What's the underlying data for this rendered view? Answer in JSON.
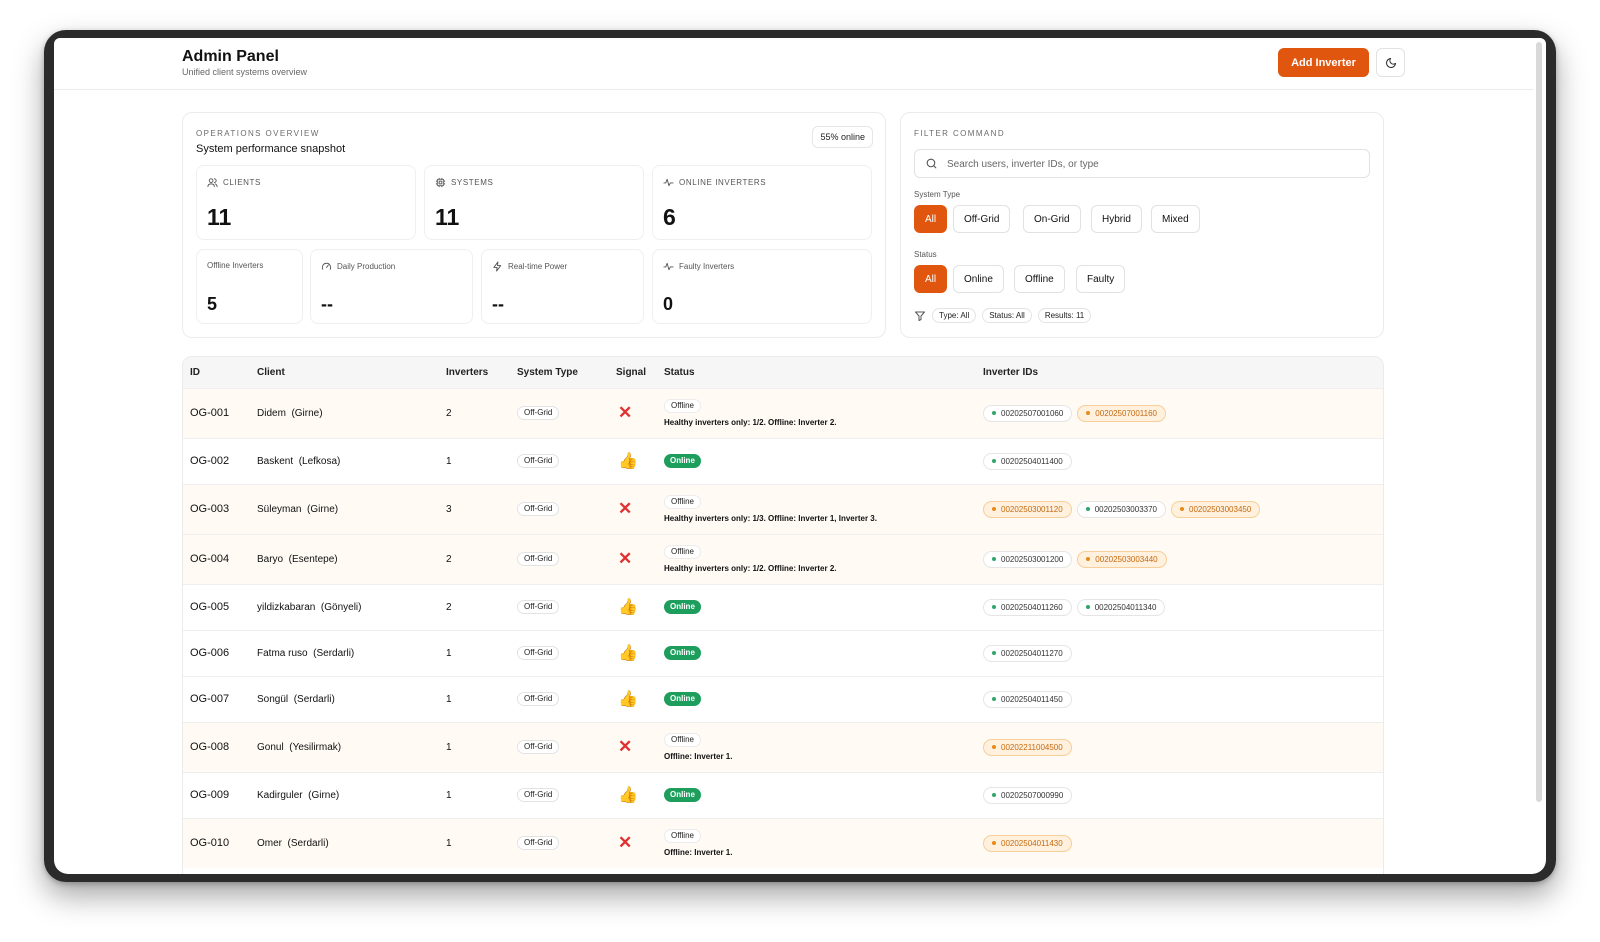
{
  "header": {
    "title": "Admin Panel",
    "subtitle": "Unified client systems overview",
    "add_button": "Add Inverter",
    "theme_icon": "moon-icon"
  },
  "overview": {
    "eyebrow": "OPERATIONS OVERVIEW",
    "title": "System performance snapshot",
    "online_pill": "55% online",
    "clients": {
      "label": "CLIENTS",
      "value": "11",
      "icon": "users-icon"
    },
    "systems": {
      "label": "SYSTEMS",
      "value": "11",
      "icon": "cpu-icon"
    },
    "online_inverters": {
      "label": "ONLINE INVERTERS",
      "value": "6",
      "icon": "activity-icon"
    },
    "offline_inverters": {
      "label": "Offline Inverters",
      "value": "5"
    },
    "daily_production": {
      "label": "Daily Production",
      "value": "--",
      "icon": "gauge-icon"
    },
    "realtime_power": {
      "label": "Real-time Power",
      "value": "--",
      "icon": "bolt-icon"
    },
    "faulty_inverters": {
      "label": "Faulty Inverters",
      "value": "0",
      "icon": "activity-icon"
    }
  },
  "filter": {
    "eyebrow": "FILTER COMMAND",
    "search_placeholder": "Search users, inverter IDs, or type",
    "system_type_label": "System Type",
    "system_types": [
      "All",
      "Off-Grid",
      "On-Grid",
      "Hybrid",
      "Mixed"
    ],
    "status_label": "Status",
    "statuses": [
      "All",
      "Online",
      "Offline",
      "Faulty"
    ],
    "summary": {
      "type": "Type: All",
      "status": "Status: All",
      "results": "Results: 11"
    }
  },
  "table": {
    "headers": {
      "id": "ID",
      "client": "Client",
      "inverters": "Inverters",
      "system_type": "System Type",
      "signal": "Signal",
      "status": "Status",
      "inverter_ids": "Inverter IDs"
    },
    "colors": {
      "online": "#1e9e5d",
      "offline_accent": "#e88a1a",
      "primary": "#e0560e"
    },
    "rows": [
      {
        "id": "OG-001",
        "client": "Didem  (Girne)",
        "inverters": "2",
        "system_type": "Off-Grid",
        "online": false,
        "status": "Offline",
        "note": "Healthy inverters only: 1/2. Offline: Inverter 2.",
        "ids": [
          {
            "v": "00202507001060",
            "ok": true
          },
          {
            "v": "00202507001160",
            "ok": false
          }
        ]
      },
      {
        "id": "OG-002",
        "client": "Baskent  (Lefkosa)",
        "inverters": "1",
        "system_type": "Off-Grid",
        "online": true,
        "status": "Online",
        "note": "",
        "ids": [
          {
            "v": "00202504011400",
            "ok": true
          }
        ]
      },
      {
        "id": "OG-003",
        "client": "Süleyman  (Girne)",
        "inverters": "3",
        "system_type": "Off-Grid",
        "online": false,
        "status": "Offline",
        "note": "Healthy inverters only: 1/3. Offline: Inverter 1, Inverter 3.",
        "ids": [
          {
            "v": "00202503001120",
            "ok": false
          },
          {
            "v": "00202503003370",
            "ok": true
          },
          {
            "v": "00202503003450",
            "ok": false
          }
        ]
      },
      {
        "id": "OG-004",
        "client": "Baryo  (Esentepe)",
        "inverters": "2",
        "system_type": "Off-Grid",
        "online": false,
        "status": "Offline",
        "note": "Healthy inverters only: 1/2. Offline: Inverter 2.",
        "ids": [
          {
            "v": "00202503001200",
            "ok": true
          },
          {
            "v": "00202503003440",
            "ok": false
          }
        ]
      },
      {
        "id": "OG-005",
        "client": "yildizkabaran  (Gönyeli)",
        "inverters": "2",
        "system_type": "Off-Grid",
        "online": true,
        "status": "Online",
        "note": "",
        "ids": [
          {
            "v": "00202504011260",
            "ok": true
          },
          {
            "v": "00202504011340",
            "ok": true
          }
        ]
      },
      {
        "id": "OG-006",
        "client": "Fatma ruso  (Serdarli)",
        "inverters": "1",
        "system_type": "Off-Grid",
        "online": true,
        "status": "Online",
        "note": "",
        "ids": [
          {
            "v": "00202504011270",
            "ok": true
          }
        ]
      },
      {
        "id": "OG-007",
        "client": "Songül  (Serdarli)",
        "inverters": "1",
        "system_type": "Off-Grid",
        "online": true,
        "status": "Online",
        "note": "",
        "ids": [
          {
            "v": "00202504011450",
            "ok": true
          }
        ]
      },
      {
        "id": "OG-008",
        "client": "Gonul  (Yesilirmak)",
        "inverters": "1",
        "system_type": "Off-Grid",
        "online": false,
        "status": "Offline",
        "note": "Offline: Inverter 1.",
        "ids": [
          {
            "v": "00202211004500",
            "ok": false
          }
        ]
      },
      {
        "id": "OG-009",
        "client": "Kadirguler  (Girne)",
        "inverters": "1",
        "system_type": "Off-Grid",
        "online": true,
        "status": "Online",
        "note": "",
        "ids": [
          {
            "v": "00202507000990",
            "ok": true
          }
        ]
      },
      {
        "id": "OG-010",
        "client": "Omer  (Serdarli)",
        "inverters": "1",
        "system_type": "Off-Grid",
        "online": false,
        "status": "Offline",
        "note": "Offline: Inverter 1.",
        "ids": [
          {
            "v": "00202504011430",
            "ok": false
          }
        ]
      }
    ]
  }
}
